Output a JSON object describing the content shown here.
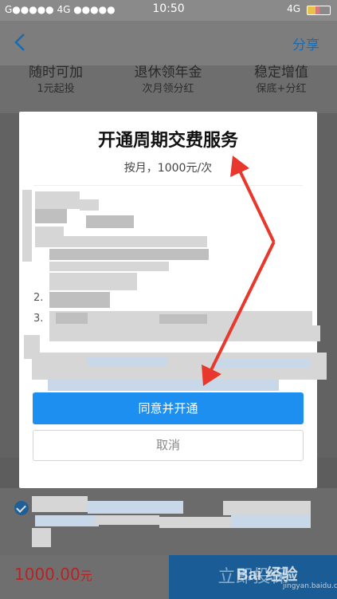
{
  "status_bar": {
    "carrier_left": "G●●●●● 4G ●●●●●",
    "time": "10:50",
    "network_right": "4G"
  },
  "nav": {
    "share_label": "分享"
  },
  "features": [
    {
      "title": "随时可加",
      "subtitle": "1元起投"
    },
    {
      "title": "退休领年金",
      "subtitle": "次月领分红"
    },
    {
      "title": "稳定增值",
      "subtitle": "保底+分红"
    }
  ],
  "modal": {
    "title": "开通周期交费服务",
    "subtitle": "按月，1000元/次",
    "list_numbers": [
      "2.",
      "3."
    ],
    "agree_label": "同意并开通",
    "cancel_label": "取消"
  },
  "footer": {
    "price": "1000.00",
    "price_unit": "元",
    "buy_label": "立即投保"
  },
  "watermark": {
    "text": "Bai 经验",
    "url": "jingyan.baidu.com"
  },
  "colors": {
    "accent_blue": "#1d8ff0",
    "price_red": "#b22222",
    "arrow_red": "#e8372c"
  }
}
